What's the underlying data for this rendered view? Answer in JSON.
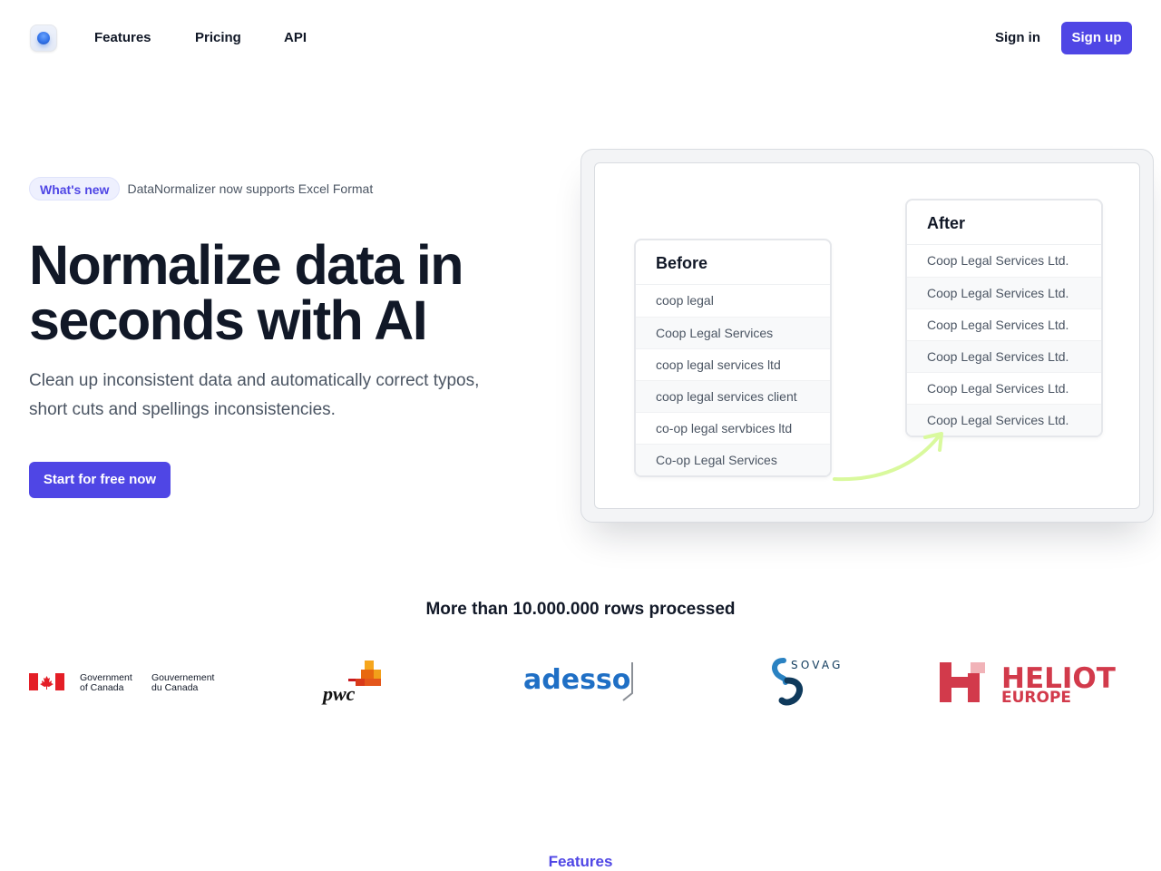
{
  "nav": {
    "links": [
      {
        "label": "Features"
      },
      {
        "label": "Pricing"
      },
      {
        "label": "API"
      }
    ],
    "signin_label": "Sign in",
    "signup_label": "Sign up"
  },
  "hero": {
    "badge": "What's new",
    "announcement": "DataNormalizer now supports Excel Format",
    "headline": "Normalize data in seconds with AI",
    "subtext": "Clean up inconsistent data and automatically correct typos, short cuts and spellings inconsistencies.",
    "cta_label": "Start for free now"
  },
  "demo": {
    "before": {
      "title": "Before",
      "rows": [
        "coop legal",
        "Coop Legal Services",
        "coop legal services ltd",
        "coop legal services client",
        "co-op legal servbices ltd",
        "Co-op Legal Services"
      ]
    },
    "after": {
      "title": "After",
      "rows": [
        "Coop Legal Services Ltd.",
        "Coop Legal Services Ltd.",
        "Coop Legal Services Ltd.",
        "Coop Legal Services Ltd.",
        "Coop Legal Services Ltd.",
        "Coop Legal Services Ltd."
      ]
    }
  },
  "stats": {
    "text": "More than 10.000.000 rows processed"
  },
  "clients": {
    "canada_en_1": "Government",
    "canada_en_2": "of Canada",
    "canada_fr_1": "Gouvernement",
    "canada_fr_2": "du Canada",
    "pwc": "pwc",
    "adesso": "adesso",
    "sovag": "SOVAG",
    "heliot_1": "HELIOT",
    "heliot_2": "EUROPE"
  },
  "sections": {
    "features_label": "Features"
  },
  "colors": {
    "accent": "#4f46e5",
    "arrow": "#d9f99d",
    "heliot_red": "#d23a4b",
    "adesso_blue": "#1f6fc5",
    "canada_red": "#e41e26",
    "sovag_navy": "#0f3a5c"
  }
}
